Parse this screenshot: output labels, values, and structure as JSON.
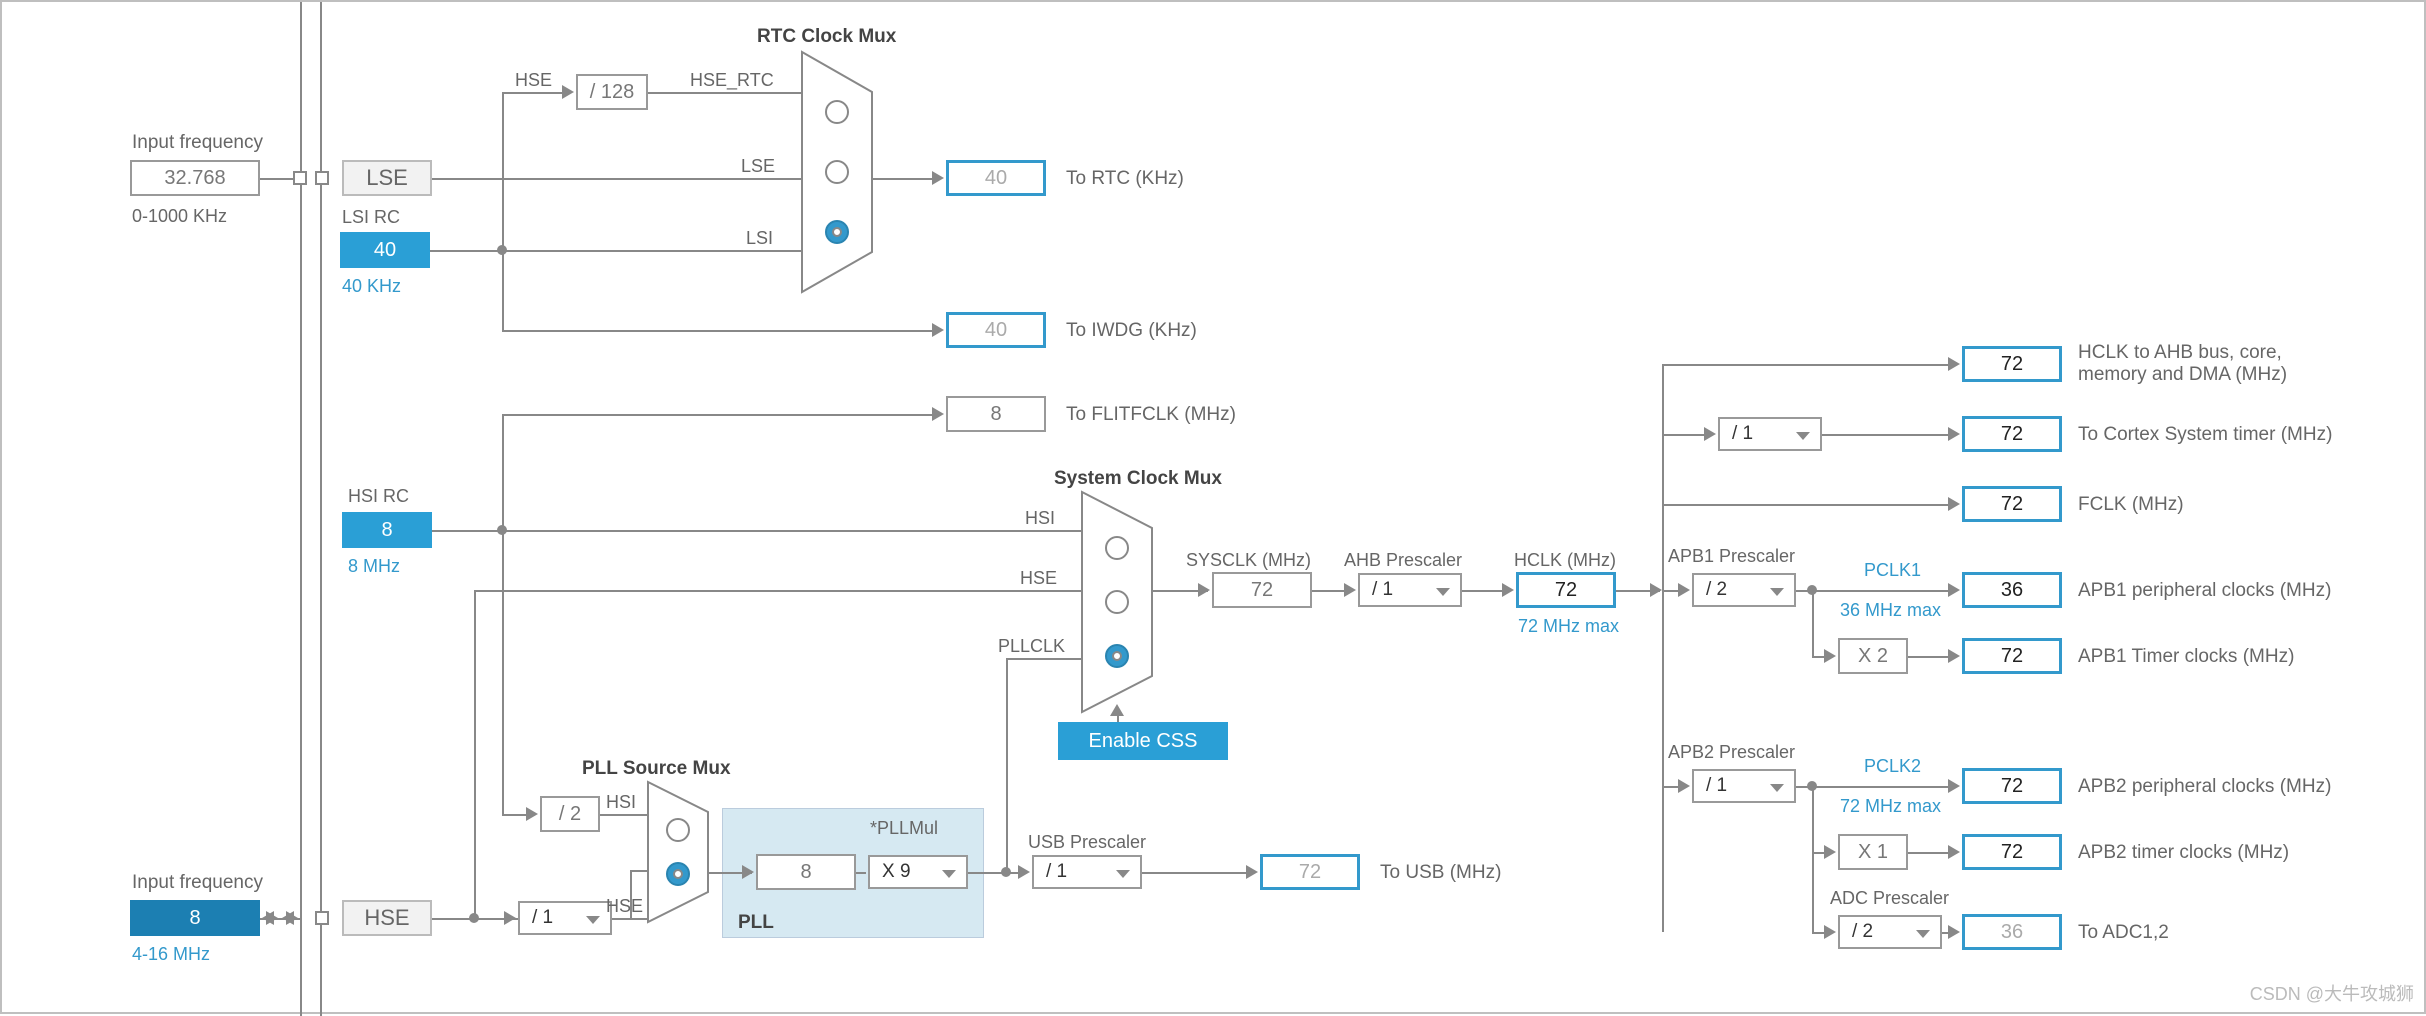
{
  "labels": {
    "input_freq1": "Input frequency",
    "range_lse": "0-1000 KHz",
    "lsi_rc": "LSI RC",
    "lsi_sub": "40 KHz",
    "hsi_rc": "HSI RC",
    "hsi_sub": "8 MHz",
    "input_freq2": "Input frequency",
    "range_hse": "4-16 MHz",
    "rtc_mux": "RTC Clock Mux",
    "pll_mux": "PLL Source Mux",
    "sys_mux": "System Clock Mux",
    "sig_hse": "HSE",
    "sig_hse_rtc": "HSE_RTC",
    "sig_lse": "LSE",
    "sig_lsi": "LSI",
    "sig_hsi": "HSI",
    "sig_pllclk": "PLLCLK",
    "pll": "PLL",
    "pllmul": "*PLLMul",
    "to_rtc": "To RTC (KHz)",
    "to_iwdg": "To IWDG (KHz)",
    "to_flt": "To FLITFCLK (MHz)",
    "usb_pre": "USB Prescaler",
    "to_usb": "To USB (MHz)",
    "sysclk": "SYSCLK (MHz)",
    "ahb_pre": "AHB Prescaler",
    "hclk": "HCLK (MHz)",
    "hclk_max": "72 MHz max",
    "hclk_ahb": "HCLK to AHB bus, core, memory and DMA (MHz)",
    "to_cortex": "To Cortex System timer (MHz)",
    "fclk": "FCLK (MHz)",
    "apb1_pre": "APB1 Prescaler",
    "pclk1": "PCLK1",
    "pclk1_max": "36 MHz max",
    "apb1_per": "APB1 peripheral clocks (MHz)",
    "apb1_tim": "APB1 Timer clocks (MHz)",
    "apb2_pre": "APB2 Prescaler",
    "pclk2": "PCLK2",
    "pclk2_max": "72 MHz max",
    "apb2_per": "APB2 peripheral clocks (MHz)",
    "apb2_tim": "APB2 timer clocks (MHz)",
    "adc_pre": "ADC Prescaler",
    "to_adc": "To ADC1,2",
    "enable_css": "Enable CSS"
  },
  "values": {
    "lse_freq": "32.768",
    "lsi": "40",
    "hsi": "8",
    "hse": "8",
    "lse_box": "LSE",
    "hse_box": "HSE",
    "hse_div": "/ 128",
    "rtc_out": "40",
    "iwdg_out": "40",
    "flt_out": "8",
    "hsi_div2": "/ 2",
    "hse_div_sel": "/ 1",
    "pll_in": "8",
    "pll_mul": "X 9",
    "usb_sel": "/ 1",
    "usb_out": "72",
    "sysclk": "72",
    "ahb_sel": "/ 1",
    "hclk_val": "72",
    "cortex_sel": "/ 1",
    "apb1_sel": "/ 2",
    "apb1_mul": "X 2",
    "apb2_sel": "/ 1",
    "apb2_mul": "X 1",
    "adc_sel": "/ 2",
    "out_hclk": "72",
    "out_cortex": "72",
    "out_fclk": "72",
    "out_apb1p": "36",
    "out_apb1t": "72",
    "out_apb2p": "72",
    "out_apb2t": "72",
    "out_adc": "36"
  },
  "watermark": "CSDN @大牛攻城狮"
}
